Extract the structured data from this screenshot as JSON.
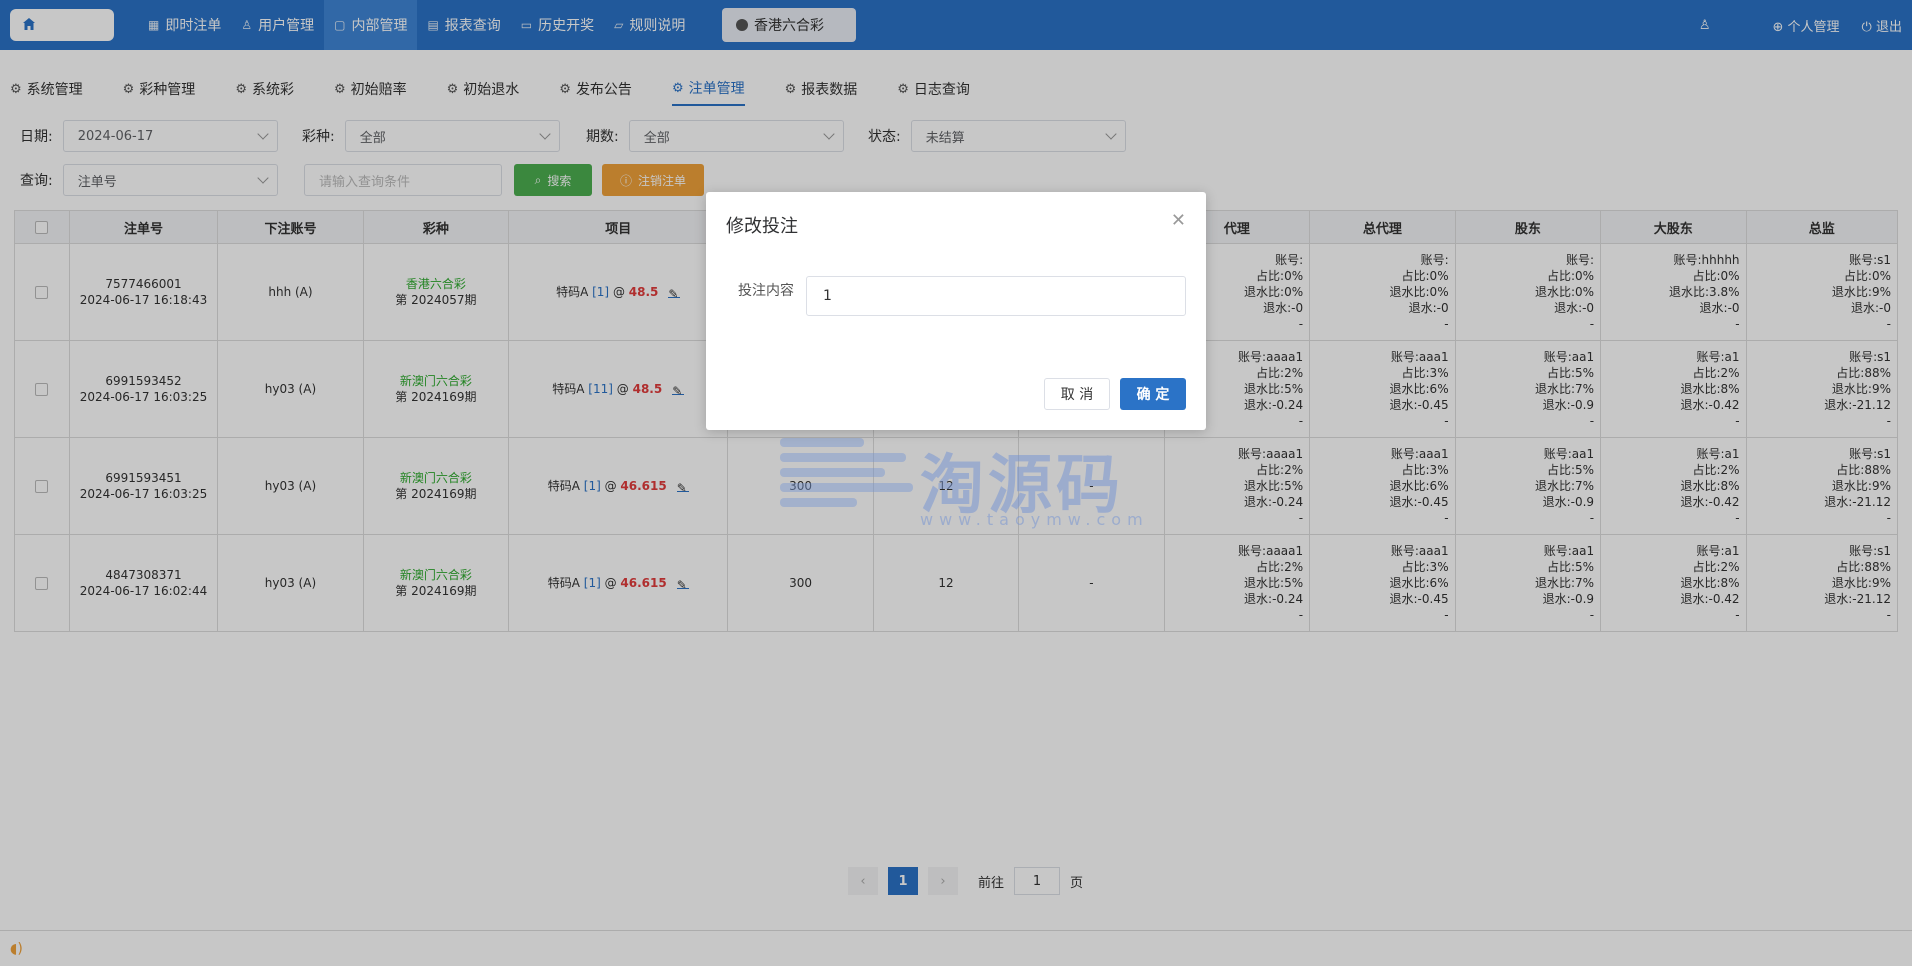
{
  "topbar": {
    "nav": [
      {
        "label": "即时注单",
        "icon": "grid-icon",
        "active": false
      },
      {
        "label": "用户管理",
        "icon": "user-icon",
        "active": false
      },
      {
        "label": "内部管理",
        "icon": "book-icon",
        "active": true
      },
      {
        "label": "报表查询",
        "icon": "report-icon",
        "active": false
      },
      {
        "label": "历史开奖",
        "icon": "monitor-icon",
        "active": false
      },
      {
        "label": "规则说明",
        "icon": "chat-icon",
        "active": false
      }
    ],
    "hk_tab": "香港六合彩",
    "personal": "个人管理",
    "logout": "退出"
  },
  "subtabs": [
    "系统管理",
    "彩种管理",
    "系统彩",
    "初始赔率",
    "初始退水",
    "发布公告",
    "注单管理",
    "报表数据",
    "日志查询"
  ],
  "filters": {
    "date_label": "日期:",
    "date_value": "2024-06-17",
    "lottery_label": "彩种:",
    "lottery_value": "全部",
    "period_label": "期数:",
    "period_value": "全部",
    "status_label": "状态:",
    "status_value": "未结算",
    "query_label": "查询:",
    "query_value": "注单号",
    "query_placeholder": "请输入查询条件",
    "search_button": "搜索",
    "cancel_order_button": "注销注单"
  },
  "table": {
    "headers": [
      "注单号",
      "下注账号",
      "彩种",
      "项目",
      "代理",
      "总代理",
      "股东",
      "大股东",
      "总监"
    ],
    "rows": [
      {
        "order_no": "7577466001",
        "time": "2024-06-17 16:18:43",
        "account": "hhh (A)",
        "lottery": "香港六合彩",
        "period": "第 2024057期",
        "item": "特码A",
        "item_num": "[1]",
        "at": "@",
        "odds": "48.5",
        "amount": "",
        "rebate": "",
        "result": "",
        "agent": [
          "账号:",
          "占比:0%",
          "退水比:0%",
          "退水:-0",
          "-"
        ],
        "gagent": [
          "账号:",
          "占比:0%",
          "退水比:0%",
          "退水:-0",
          "-"
        ],
        "share": [
          "账号:",
          "占比:0%",
          "退水比:0%",
          "退水:-0",
          "-"
        ],
        "bshare": [
          "账号:hhhhh",
          "占比:0%",
          "退水比:3.8%",
          "退水:-0",
          "-"
        ],
        "director": [
          "账号:s1",
          "占比:0%",
          "退水比:9%",
          "退水:-0",
          "-"
        ]
      },
      {
        "order_no": "6991593452",
        "time": "2024-06-17 16:03:25",
        "account": "hy03 (A)",
        "lottery": "新澳门六合彩",
        "period": "第 2024169期",
        "item": "特码A",
        "item_num": "[11]",
        "at": "@",
        "odds": "48.5",
        "amount": "",
        "rebate": "",
        "result": "",
        "agent": [
          "账号:aaaa1",
          "占比:2%",
          "退水比:5%",
          "退水:-0.24",
          "-"
        ],
        "gagent": [
          "账号:aaa1",
          "占比:3%",
          "退水比:6%",
          "退水:-0.45",
          "-"
        ],
        "share": [
          "账号:aa1",
          "占比:5%",
          "退水比:7%",
          "退水:-0.9",
          "-"
        ],
        "bshare": [
          "账号:a1",
          "占比:2%",
          "退水比:8%",
          "退水:-0.42",
          "-"
        ],
        "director": [
          "账号:s1",
          "占比:88%",
          "退水比:9%",
          "退水:-21.12",
          "-"
        ]
      },
      {
        "order_no": "6991593451",
        "time": "2024-06-17 16:03:25",
        "account": "hy03 (A)",
        "lottery": "新澳门六合彩",
        "period": "第 2024169期",
        "item": "特码A",
        "item_num": "[1]",
        "at": "@",
        "odds": "46.615",
        "amount": "300",
        "rebate": "12",
        "result": "-",
        "agent": [
          "账号:aaaa1",
          "占比:2%",
          "退水比:5%",
          "退水:-0.24",
          "-"
        ],
        "gagent": [
          "账号:aaa1",
          "占比:3%",
          "退水比:6%",
          "退水:-0.45",
          "-"
        ],
        "share": [
          "账号:aa1",
          "占比:5%",
          "退水比:7%",
          "退水:-0.9",
          "-"
        ],
        "bshare": [
          "账号:a1",
          "占比:2%",
          "退水比:8%",
          "退水:-0.42",
          "-"
        ],
        "director": [
          "账号:s1",
          "占比:88%",
          "退水比:9%",
          "退水:-21.12",
          "-"
        ]
      },
      {
        "order_no": "4847308371",
        "time": "2024-06-17 16:02:44",
        "account": "hy03 (A)",
        "lottery": "新澳门六合彩",
        "period": "第 2024169期",
        "item": "特码A",
        "item_num": "[1]",
        "at": "@",
        "odds": "46.615",
        "amount": "300",
        "rebate": "12",
        "result": "-",
        "agent": [
          "账号:aaaa1",
          "占比:2%",
          "退水比:5%",
          "退水:-0.24",
          "-"
        ],
        "gagent": [
          "账号:aaa1",
          "占比:3%",
          "退水比:6%",
          "退水:-0.45",
          "-"
        ],
        "share": [
          "账号:aa1",
          "占比:5%",
          "退水比:7%",
          "退水:-0.9",
          "-"
        ],
        "bshare": [
          "账号:a1",
          "占比:2%",
          "退水比:8%",
          "退水:-0.42",
          "-"
        ],
        "director": [
          "账号:s1",
          "占比:88%",
          "退水比:9%",
          "退水:-21.12",
          "-"
        ]
      }
    ]
  },
  "pagination": {
    "prev": "‹",
    "current": "1",
    "next": "›",
    "goto_label": "前往",
    "goto_value": "1",
    "page_label": "页"
  },
  "watermark": {
    "logo_text": "淘源码",
    "url_text": "www.taoymw.com"
  },
  "modal": {
    "title": "修改投注",
    "field_label": "投注内容",
    "field_value": "1",
    "cancel": "取 消",
    "confirm": "确 定"
  },
  "colors": {
    "primary": "#2b73c7",
    "green": "#4caf50",
    "orange": "#f0a23a",
    "odds_red": "#e23c3c",
    "lottery_green": "#2eaa2e"
  }
}
